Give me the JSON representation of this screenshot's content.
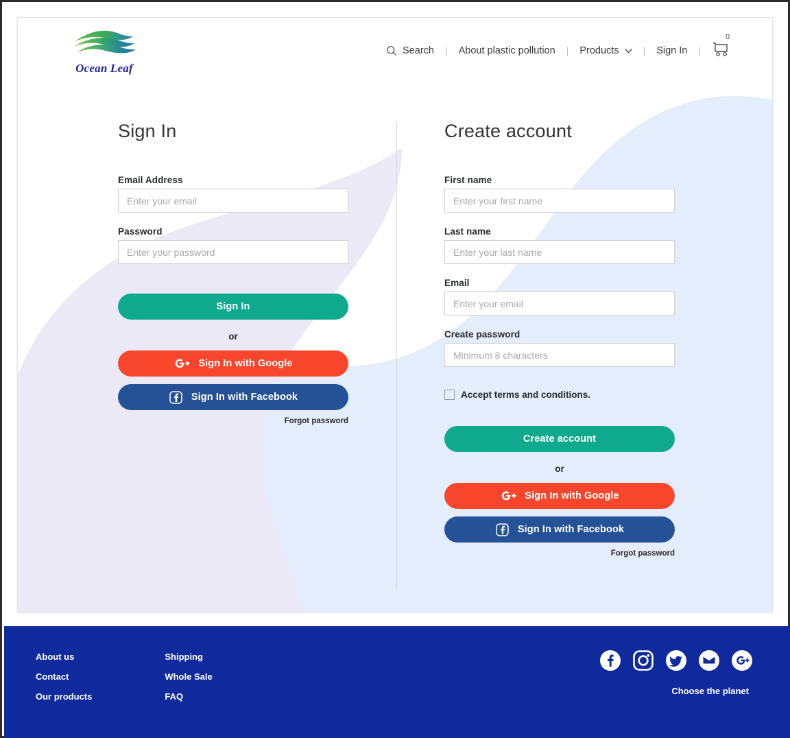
{
  "brand": {
    "name": "Ocean Leaf",
    "logo_icon": "ocean-leaf-wave-logo"
  },
  "nav": {
    "search_label": "Search",
    "search_icon": "search-icon",
    "items": [
      {
        "label": "About plastic pollution"
      },
      {
        "label": "Products",
        "icon": "chevron-down-icon"
      },
      {
        "label": "Sign In"
      }
    ],
    "separator": "|",
    "cart_icon": "shopping-cart-icon",
    "cart_count": "0"
  },
  "signin": {
    "title": "Sign In",
    "email_label": "Email Address",
    "email_placeholder": "Enter your email",
    "password_label": "Password",
    "password_placeholder": "Enter your password",
    "submit_label": "Sign In",
    "or_label": "or",
    "google_label": "Sign In with Google",
    "facebook_label": "Sign In with Facebook",
    "forgot_label": "Forgot password"
  },
  "create": {
    "title": "Create account",
    "first_label": "First name",
    "first_placeholder": "Enter your first name",
    "last_label": "Last name",
    "last_placeholder": "Enter your last name",
    "email_label": "Email",
    "email_placeholder": "Enter your email",
    "password_label": "Create password",
    "password_placeholder": "Minimum 8 characters",
    "terms_label": "Accept terms and conditions.",
    "submit_label": "Create account",
    "or_label": "or",
    "google_label": "Sign In with Google",
    "facebook_label": "Sign In with Facebook",
    "forgot_label": "Forgot password"
  },
  "footer": {
    "col1": [
      {
        "label": "About us"
      },
      {
        "label": "Contact"
      },
      {
        "label": "Our products"
      }
    ],
    "col2": [
      {
        "label": "Shipping"
      },
      {
        "label": "Whole Sale"
      },
      {
        "label": "FAQ"
      }
    ],
    "social": [
      {
        "icon": "facebook-icon"
      },
      {
        "icon": "instagram-icon"
      },
      {
        "icon": "twitter-icon"
      },
      {
        "icon": "email-icon"
      },
      {
        "icon": "google-plus-icon"
      }
    ],
    "tagline": "Choose the planet"
  },
  "colors": {
    "primary_teal": "#0faa8e",
    "google_red": "#f8462c",
    "facebook_blue": "#255296",
    "footer_blue": "#0e2a9c",
    "logo_navy": "#20219b",
    "blob_lavender": "#ece9f7",
    "blob_blue": "#e3ecfb"
  }
}
